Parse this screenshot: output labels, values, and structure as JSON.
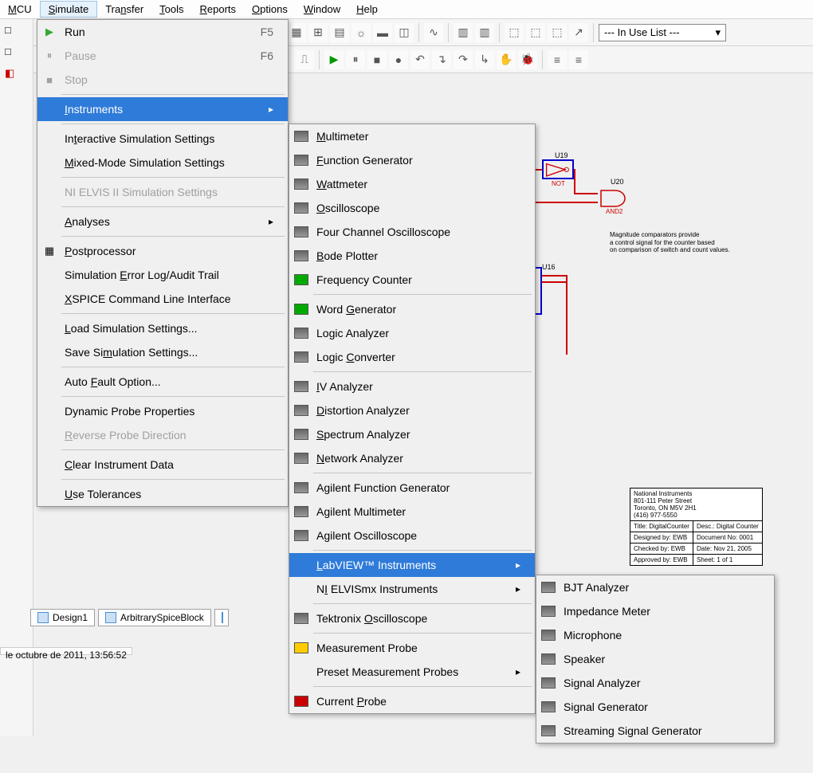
{
  "menubar": {
    "items": [
      "MCU",
      "Simulate",
      "Transfer",
      "Tools",
      "Reports",
      "Options",
      "Window",
      "Help"
    ]
  },
  "toolbar_right_box": "--- In Use List ---",
  "simulate_menu": {
    "run": "Run",
    "run_key": "F5",
    "pause": "Pause",
    "pause_key": "F6",
    "stop": "Stop",
    "instruments": "Instruments",
    "iss": "Interactive Simulation Settings",
    "mms": "Mixed-Mode Simulation Settings",
    "nielvis": "NI ELVIS II Simulation Settings",
    "analyses": "Analyses",
    "postprocessor": "Postprocessor",
    "error_log": "Simulation Error Log/Audit Trail",
    "xspice": "XSPICE Command Line Interface",
    "load_sim": "Load Simulation Settings...",
    "save_sim": "Save Simulation Settings...",
    "auto_fault": "Auto Fault Option...",
    "dyn_probe": "Dynamic Probe Properties",
    "rev_probe": "Reverse Probe Direction",
    "clear_instr": "Clear Instrument Data",
    "use_tol": "Use Tolerances"
  },
  "instruments_menu": {
    "multimeter": "Multimeter",
    "func_gen": "Function Generator",
    "wattmeter": "Wattmeter",
    "oscilloscope": "Oscilloscope",
    "four_ch_osc": "Four Channel Oscilloscope",
    "bode": "Bode Plotter",
    "freq_counter": "Frequency Counter",
    "word_gen": "Word Generator",
    "logic_analyzer": "Logic Analyzer",
    "logic_conv": "Logic Converter",
    "iv_analyzer": "IV Analyzer",
    "distortion": "Distortion Analyzer",
    "spectrum": "Spectrum Analyzer",
    "network": "Network Analyzer",
    "agilent_fg": "Agilent Function Generator",
    "agilent_mm": "Agilent Multimeter",
    "agilent_osc": "Agilent Oscilloscope",
    "labview": "LabVIEW™ Instruments",
    "ni_elvis_mx": "NI ELVISmx Instruments",
    "tek_osc": "Tektronix Oscilloscope",
    "meas_probe": "Measurement Probe",
    "preset_probes": "Preset Measurement Probes",
    "current_probe": "Current Probe"
  },
  "labview_submenu": {
    "bjt": "BJT Analyzer",
    "impedance": "Impedance Meter",
    "microphone": "Microphone",
    "speaker": "Speaker",
    "sig_analyzer": "Signal Analyzer",
    "sig_gen": "Signal Generator",
    "stream_sig_gen": "Streaming Signal Generator"
  },
  "tabs": [
    "Design1",
    "ArbitrarySpiceBlock"
  ],
  "status_text": "le octubre de 2011, 13:56:52",
  "schematic": {
    "note_l1": "Magnitude comparators provide",
    "note_l2": "a control signal for the counter based",
    "note_l3": "on comparison of switch and count values.",
    "u19": "U19",
    "u20": "U20",
    "u16": "U16",
    "not": "NOT",
    "and2": "AND2"
  },
  "titleblock": {
    "company": "National Instruments",
    "addr1": "801-111 Peter Street",
    "addr2": "Toronto, ON M5V 2H1",
    "phone": "(416) 977-5550",
    "title_lbl": "Title:",
    "title_val": "DigitalCounter",
    "desc_lbl": "Desc.:",
    "desc_val": "Digital Counter",
    "designed_lbl": "Designed by:",
    "designed_val": "EWB",
    "doc_lbl": "Document No:",
    "doc_val": "0001",
    "checked_lbl": "Checked by:",
    "checked_val": "EWB",
    "date_lbl": "Date:",
    "date_val": "Nov 21, 2005",
    "approved_lbl": "Approved by:",
    "approved_val": "EWB",
    "sheet_lbl": "Sheet:",
    "sheet_val": "1   of   1"
  }
}
